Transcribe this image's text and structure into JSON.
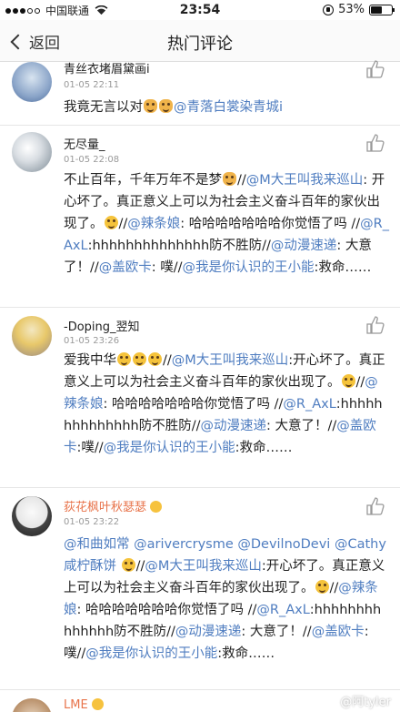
{
  "status_bar": {
    "carrier": "中国联通",
    "time": "23:54",
    "battery": "53%",
    "battery_level": 0.53
  },
  "nav": {
    "back_label": "返回",
    "title": "热门评论"
  },
  "comments": [
    {
      "username": "青丝衣堵眉黛画i",
      "time": "01-05 22:11",
      "segments": [
        {
          "t": "我竟无言以对"
        },
        {
          "emoji": "dog-face"
        },
        {
          "emoji": "dog-face"
        },
        {
          "at": "@青落白裳染青城i"
        }
      ]
    },
    {
      "username": "无尽量_",
      "time": "01-05 22:08",
      "segments": [
        {
          "t": "不止百年，千年万年不是梦"
        },
        {
          "emoji": "dog-face"
        },
        {
          "t": "//"
        },
        {
          "at": "@M大王叫我来巡山"
        },
        {
          "t": ": 开心坏了。真正意义上可以为社会主义奋斗百年的家伙出现了。"
        },
        {
          "emoji": "laugh"
        },
        {
          "t": "//"
        },
        {
          "at": "@辣条娘"
        },
        {
          "t": ": 哈哈哈哈哈哈哈你觉悟了吗 //"
        },
        {
          "at": "@R_AxL"
        },
        {
          "t": ":hhhhhhhhhhhhhh防不胜防//"
        },
        {
          "at": "@动漫速递"
        },
        {
          "t": ": 大意了！//"
        },
        {
          "at": "@盖欧卡"
        },
        {
          "t": ": 噗//"
        },
        {
          "at": "@我是你认识的王小能"
        },
        {
          "t": ":救命……"
        }
      ]
    },
    {
      "username": "-Doping_翌知",
      "time": "01-05 23:26",
      "segments": [
        {
          "t": "爱我中华"
        },
        {
          "emoji": "laugh"
        },
        {
          "emoji": "laugh"
        },
        {
          "emoji": "laugh"
        },
        {
          "t": "//"
        },
        {
          "at": "@M大王叫我来巡山"
        },
        {
          "t": ":开心坏了。真正意义上可以为社会主义奋斗百年的家伙出现了。"
        },
        {
          "emoji": "laugh"
        },
        {
          "t": "//"
        },
        {
          "at": "@辣条娘"
        },
        {
          "t": ": 哈哈哈哈哈哈哈你觉悟了吗 //"
        },
        {
          "at": "@R_AxL"
        },
        {
          "t": ":hhhhhhhhhhhhhh防不胜防//"
        },
        {
          "at": "@动漫速递"
        },
        {
          "t": ": 大意了！//"
        },
        {
          "at": "@盖欧卡"
        },
        {
          "t": ":噗//"
        },
        {
          "at": "@我是你认识的王小能"
        },
        {
          "t": ":救命……"
        }
      ]
    },
    {
      "username": "荻花枫叶秋瑟瑟",
      "time": "01-05 23:22",
      "vip": true,
      "segments": [
        {
          "at": "@和曲如常"
        },
        {
          "t": " "
        },
        {
          "at": "@arivercrysme"
        },
        {
          "t": " "
        },
        {
          "at": "@DevilnoDevi"
        },
        {
          "t": " "
        },
        {
          "at": "@Cathy咸柠酥饼"
        },
        {
          "t": " "
        },
        {
          "emoji": "laugh"
        },
        {
          "t": "//"
        },
        {
          "at": "@M大王叫我来巡山"
        },
        {
          "t": ":开心坏了。真正意义上可以为社会主义奋斗百年的家伙出现了。"
        },
        {
          "emoji": "laugh"
        },
        {
          "t": "//"
        },
        {
          "at": "@辣条娘"
        },
        {
          "t": ": 哈哈哈哈哈哈哈你觉悟了吗 //"
        },
        {
          "at": "@R_AxL"
        },
        {
          "t": ":hhhhhhhhhhhhhh防不胜防//"
        },
        {
          "at": "@动漫速递"
        },
        {
          "t": ": 大意了！//"
        },
        {
          "at": "@盖欧卡"
        },
        {
          "t": ":噗//"
        },
        {
          "at": "@我是你认识的王小能"
        },
        {
          "t": ":救命……"
        }
      ]
    },
    {
      "username": "LME",
      "time": "",
      "vip": true,
      "segments": []
    }
  ],
  "watermark": "@阿tyler",
  "colors": {
    "mention": "#4f7dc0",
    "vip_name": "#e8734a",
    "divider": "#e6e6e6"
  }
}
